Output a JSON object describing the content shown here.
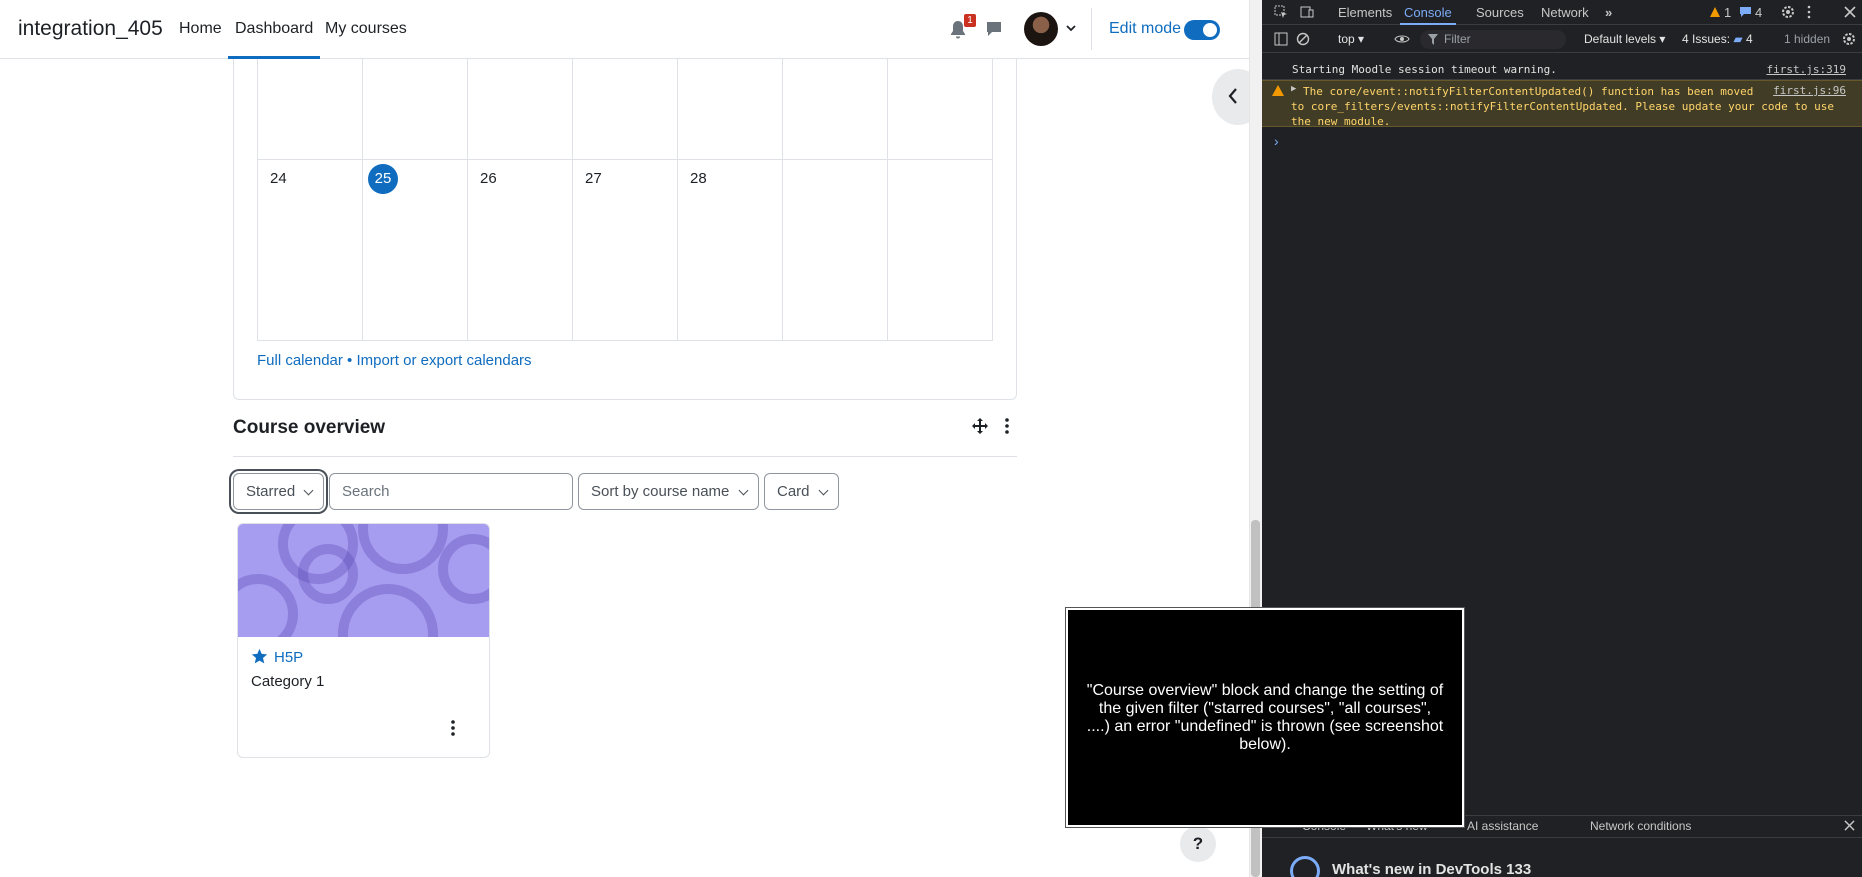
{
  "navbar": {
    "site_name": "integration_405",
    "links": [
      "Home",
      "Dashboard",
      "My courses"
    ],
    "notification_count": "1",
    "edit_mode_label": "Edit mode"
  },
  "calendar": {
    "row1": [
      "",
      "",
      "",
      "",
      "",
      "",
      ""
    ],
    "row2": [
      "24",
      "25",
      "26",
      "27",
      "28",
      "",
      ""
    ],
    "today": "25",
    "links": "Full calendar • Import or export calendars"
  },
  "course_overview": {
    "title": "Course overview",
    "filter": "Starred",
    "search_placeholder": "Search",
    "sort": "Sort by course name",
    "view": "Card",
    "courses": [
      {
        "name": "H5P",
        "category": "Category 1"
      }
    ]
  },
  "help_label": "?",
  "devtools": {
    "tabs": [
      "Elements",
      "Console",
      "Sources",
      "Network"
    ],
    "active_tab": "Console",
    "warn_count": "1",
    "msg_count": "4",
    "context": "top",
    "filter_placeholder": "Filter",
    "levels": "Default levels",
    "issues": "4 Issues:",
    "issues_count": "4",
    "hidden": "1 hidden",
    "logs": [
      {
        "text": "Starting Moodle session timeout warning.",
        "source": "first.js:319"
      },
      {
        "text_lines": [
          "The core/event::notifyFilterContentUpdated() function has been moved",
          "to core_filters/events::notifyFilterContentUpdated. Please update your code to use",
          "the new module."
        ],
        "source": "first.js:96"
      }
    ],
    "drawer_tabs": [
      "Console",
      "What's new",
      "AI assistance",
      "Network conditions"
    ],
    "whats_new_title": "What's new in DevTools 133"
  },
  "overlay": {
    "text": "\"Course overview\" block and change the setting of the given filter (\"starred courses\", \"all courses\", ....) an error \"undefined\" is thrown (see screenshot below)."
  }
}
